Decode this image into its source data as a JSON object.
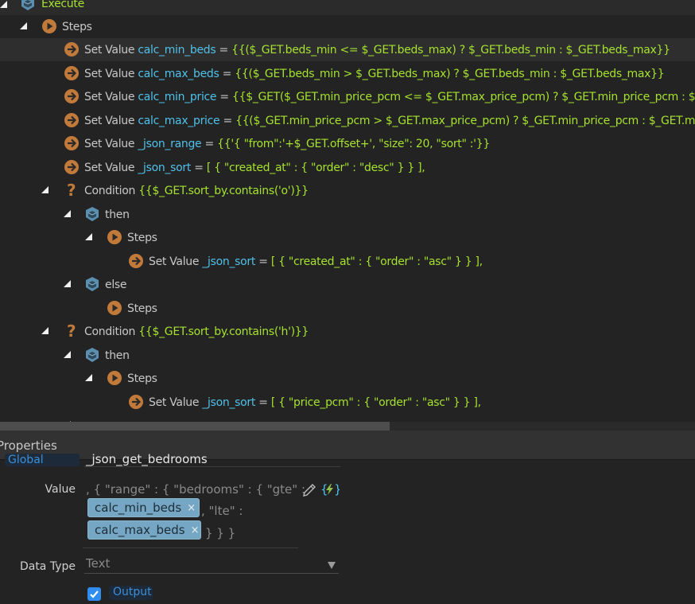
{
  "tree": {
    "execute_label": "Execute",
    "rows": [
      {
        "kind": "steps",
        "label": "Steps"
      },
      {
        "kind": "set",
        "prefix": "Set Value",
        "var": "calc_min_beds",
        "eq": "=",
        "expr": "{{($_GET.beds_min <= $_GET.beds_max) ? $_GET.beds_min : $_GET.beds_max}}"
      },
      {
        "kind": "set",
        "prefix": "Set Value",
        "var": "calc_max_beds",
        "eq": "=",
        "expr": "{{($_GET.beds_min > $_GET.beds_max) ? $_GET.beds_min : $_GET.beds_max}}"
      },
      {
        "kind": "set",
        "prefix": "Set Value",
        "var": "calc_min_price",
        "eq": "=",
        "expr": "{{$_GET($_GET.min_price_pcm <= $_GET.max_price_pcm) ? $_GET.min_price_pcm : $_GET.max_price_pcm}}"
      },
      {
        "kind": "set",
        "prefix": "Set Value",
        "var": "calc_max_price",
        "eq": "=",
        "expr": "{{($_GET.min_price_pcm > $_GET.max_price_pcm) ? $_GET.min_price_pcm : $_GET.max_price_pcm}}"
      },
      {
        "kind": "set",
        "prefix": "Set Value",
        "var": "_json_range",
        "eq": "=",
        "expr": "{{'{ \"from\":'+$_GET.offset+', \"size\": 20, \"sort\" :'}}"
      },
      {
        "kind": "set",
        "prefix": "Set Value",
        "var": "_json_sort",
        "eq": "=",
        "expr": "[ { \"created_at\" : { \"order\" : \"desc\" } } ],"
      },
      {
        "kind": "cond",
        "prefix": "Condition",
        "expr": "{{$_GET.sort_by.contains('o')}}"
      },
      {
        "kind": "branch",
        "label": "then"
      },
      {
        "kind": "steps",
        "label": "Steps"
      },
      {
        "kind": "set",
        "prefix": "Set Value",
        "var": "_json_sort",
        "eq": "=",
        "expr": "[ { \"created_at\" : { \"order\" : \"asc\" } } ],"
      },
      {
        "kind": "branch",
        "label": "else"
      },
      {
        "kind": "steps",
        "label": "Steps"
      },
      {
        "kind": "cond",
        "prefix": "Condition",
        "expr": "{{$_GET.sort_by.contains('h')}}"
      },
      {
        "kind": "branch",
        "label": "then"
      },
      {
        "kind": "steps",
        "label": "Steps"
      },
      {
        "kind": "set",
        "prefix": "Set Value",
        "var": "_json_sort",
        "eq": "=",
        "expr": "[ { \"price_pcm\" : { \"order\" : \"asc\" } } ],"
      }
    ]
  },
  "properties": {
    "title": "Properties",
    "global_name_label": "Global Name",
    "global_name_value": "_json_get_bedrooms",
    "value_label": "Value",
    "value_text_1": ", { \"range\" : { \"bedrooms\" : { \"gte\" :",
    "chip_1": "calc_min_beds",
    "value_text_2": ", \"lte\" :",
    "chip_2": "calc_max_beds",
    "value_text_3": "} } }",
    "chip_remove": "×",
    "data_type_label": "Data Type",
    "data_type_value": "Text",
    "output_label": "Output",
    "output_checked": true
  },
  "colors": {
    "variable": "#4fc1e9",
    "expression": "#a6e22e",
    "step_icon": "#c27a3a",
    "branch_icon": "#5b8fb0",
    "chip": "#75a6c3",
    "checkbox": "#2f8cf0"
  }
}
